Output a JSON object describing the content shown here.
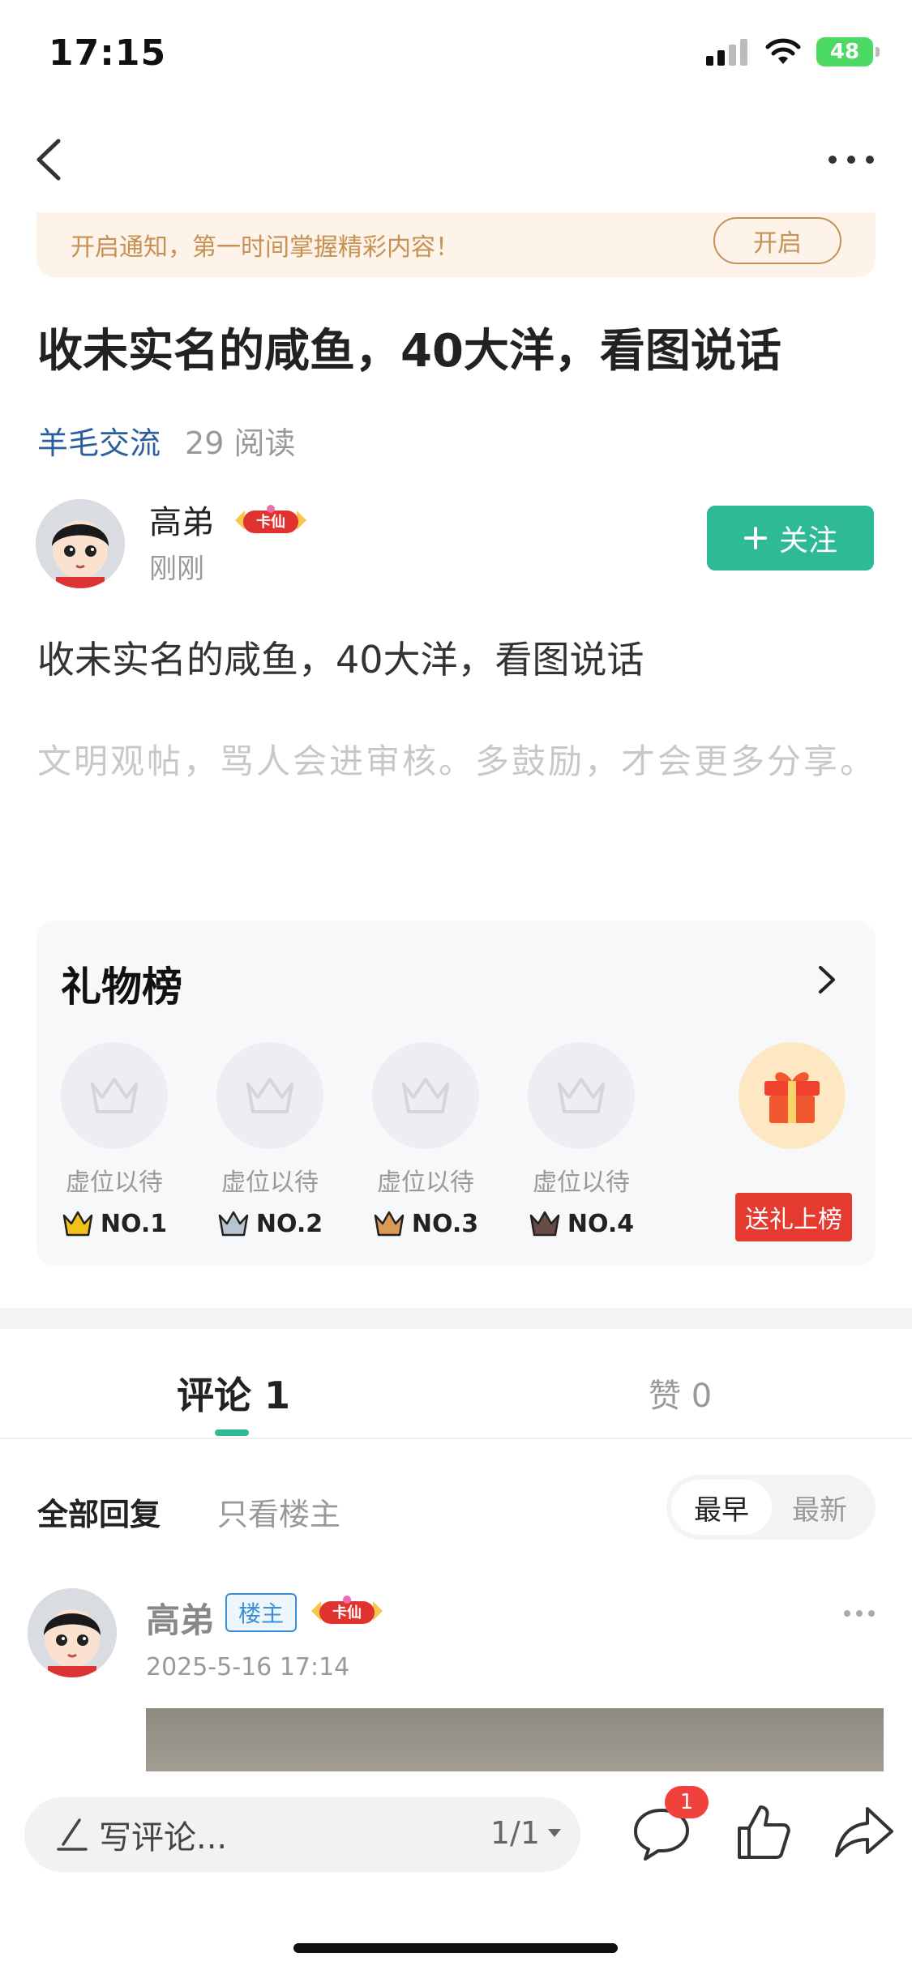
{
  "status": {
    "time": "17:15",
    "battery": "48"
  },
  "notice": {
    "text": "开启通知，第一时间掌握精彩内容！",
    "button": "开启"
  },
  "post": {
    "title": "收未实名的咸鱼，40大洋，看图说话",
    "category": "羊毛交流",
    "reads": "29 阅读",
    "author": "高弟",
    "badge": "卡仙",
    "time": "刚刚",
    "follow": "关注",
    "body": "收未实名的咸鱼，40大洋，看图说话",
    "hint": "文明观帖，骂人会进审核。多鼓励，才会更多分享。"
  },
  "gift": {
    "title": "礼物榜",
    "slots": [
      {
        "label": "虚位以待",
        "rank": "NO.1",
        "crown": "#f2c21b"
      },
      {
        "label": "虚位以待",
        "rank": "NO.2",
        "crown": "#b8c4d2"
      },
      {
        "label": "虚位以待",
        "rank": "NO.3",
        "crown": "#d99a55"
      },
      {
        "label": "虚位以待",
        "rank": "NO.4",
        "crown": "#6b4a4a"
      }
    ],
    "send": "送礼上榜"
  },
  "tabs": {
    "comments": "评论 1",
    "likes": "赞 0"
  },
  "filters": {
    "all": "全部回复",
    "op_only": "只看楼主",
    "sort_earliest": "最早",
    "sort_latest": "最新"
  },
  "comment": {
    "author": "高弟",
    "op_badge": "楼主",
    "badge": "卡仙",
    "date": "2025-5-16 17:14"
  },
  "bottom": {
    "placeholder": "写评论...",
    "page": "1/1",
    "comment_count": "1"
  }
}
